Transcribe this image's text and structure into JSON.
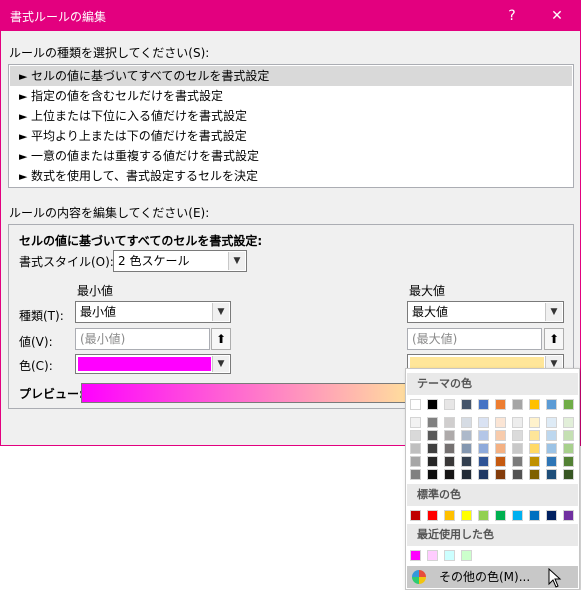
{
  "window": {
    "title": "書式ルールの編集",
    "help_label": "?",
    "close_label": "✕",
    "title_bar_color": "#e3007f"
  },
  "rule_type": {
    "label": "ルールの種類を選択してください(S):",
    "items": [
      {
        "text": "セルの値に基づいてすべてのセルを書式設定",
        "selected": true
      },
      {
        "text": "指定の値を含むセルだけを書式設定",
        "selected": false
      },
      {
        "text": "上位または下位に入る値だけを書式設定",
        "selected": false
      },
      {
        "text": "平均より上または下の値だけを書式設定",
        "selected": false
      },
      {
        "text": "一意の値または重複する値だけを書式設定",
        "selected": false
      },
      {
        "text": "数式を使用して、書式設定するセルを決定",
        "selected": false
      }
    ]
  },
  "rule_edit": {
    "label": "ルールの内容を編集してください(E):",
    "heading": "セルの値に基づいてすべてのセルを書式設定:",
    "format_style_label": "書式スタイル(O):",
    "format_style_value": "2 色スケール",
    "min_header": "最小値",
    "max_header": "最大値",
    "type_label": "種類(T):",
    "value_label": "値(V):",
    "color_label": "色(C):",
    "min_type": "最小値",
    "max_type": "最大値",
    "min_value_placeholder": "(最小値)",
    "max_value_placeholder": "(最大値)",
    "min_color": "#ff00ff",
    "max_color": "#ffe699",
    "preview_label": "プレビュー:"
  },
  "palette": {
    "theme_header": "テーマの色",
    "standard_header": "標準の色",
    "recent_header": "最近使用した色",
    "more_colors_label": "その他の色(M)...",
    "theme_top": [
      "#ffffff",
      "#000000",
      "#e7e6e6",
      "#44546a",
      "#4472c4",
      "#ed7d31",
      "#a5a5a5",
      "#ffc000",
      "#5b9bd5",
      "#70ad47"
    ],
    "theme_shades": [
      [
        "#f2f2f2",
        "#d9d9d9",
        "#bfbfbf",
        "#a6a6a6",
        "#808080"
      ],
      [
        "#808080",
        "#595959",
        "#404040",
        "#262626",
        "#0d0d0d"
      ],
      [
        "#d0cece",
        "#aeaaaa",
        "#757171",
        "#3a3838",
        "#171616"
      ],
      [
        "#d6dce4",
        "#adb9ca",
        "#8497b0",
        "#333f4f",
        "#222a35"
      ],
      [
        "#d9e2f3",
        "#b4c6e7",
        "#8eaadb",
        "#2f5496",
        "#1f3864"
      ],
      [
        "#fbe5d5",
        "#f7cbac",
        "#f4b183",
        "#c55a11",
        "#833c0b"
      ],
      [
        "#ededed",
        "#dbdbdb",
        "#c9c9c9",
        "#7b7b7b",
        "#525252"
      ],
      [
        "#fff2cc",
        "#fee599",
        "#ffd966",
        "#bf9000",
        "#7f6000"
      ],
      [
        "#deebf6",
        "#bdd7ee",
        "#9cc3e5",
        "#2e75b5",
        "#1e4e79"
      ],
      [
        "#e2efd9",
        "#c5e0b3",
        "#a8d08d",
        "#538135",
        "#375623"
      ]
    ],
    "standard": [
      "#c00000",
      "#ff0000",
      "#ffc000",
      "#ffff00",
      "#92d050",
      "#00b050",
      "#00b0f0",
      "#0070c0",
      "#002060",
      "#7030a0"
    ],
    "recent": [
      "#ff00ff",
      "#ffccff",
      "#ccffff",
      "#ccffcc"
    ]
  }
}
